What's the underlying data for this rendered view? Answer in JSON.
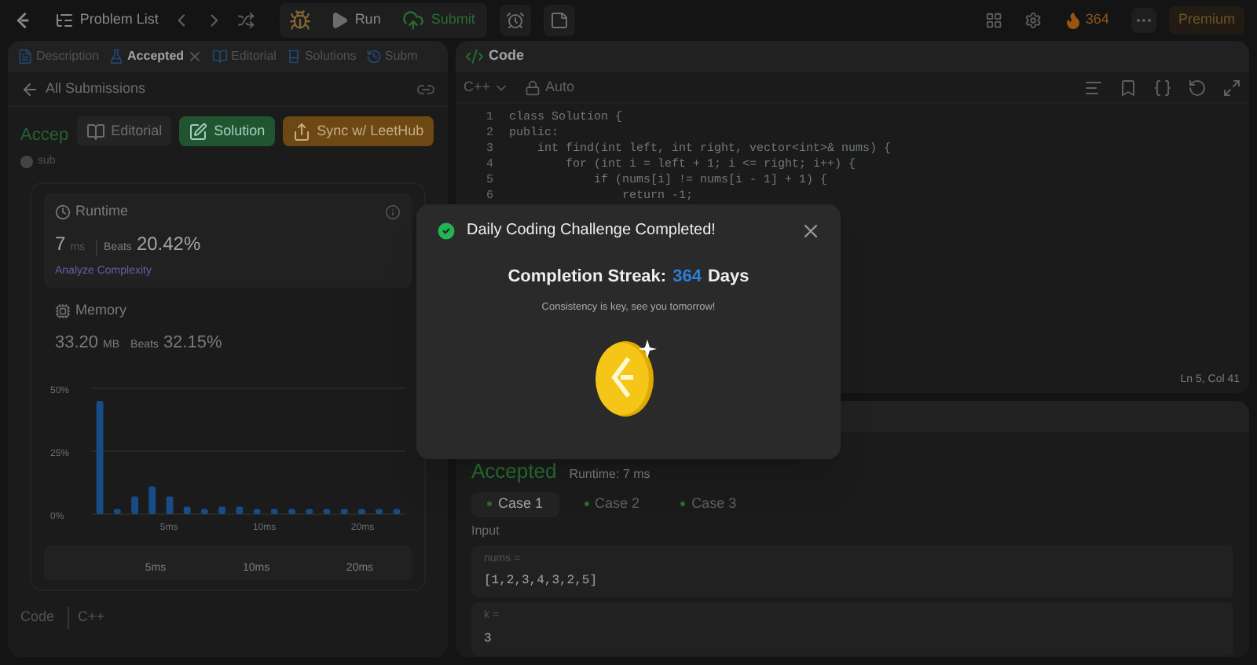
{
  "top_bar": {
    "problem_list": "Problem List",
    "run": "Run",
    "submit": "Submit",
    "streak": "364",
    "premium": "Premium"
  },
  "left_panel": {
    "tabs": [
      {
        "label": "Description",
        "selected": false
      },
      {
        "label": "Accepted",
        "selected": true,
        "closable": true
      },
      {
        "label": "Editorial",
        "selected": false
      },
      {
        "label": "Solutions",
        "selected": false
      },
      {
        "label": "Subm",
        "selected": false
      }
    ],
    "back_link": "All Submissions",
    "status": "Accep",
    "user": "sub",
    "buttons": [
      {
        "label": "Editorial",
        "kind": "plain"
      },
      {
        "label": "Solution",
        "kind": "green"
      },
      {
        "label": "Sync w/ LeetHub",
        "kind": "orange"
      }
    ],
    "runtime": {
      "title": "Runtime",
      "value": "7",
      "unit": "ms",
      "beats_label": "Beats",
      "beats": "20.42%",
      "analyze": "Analyze Complexity"
    },
    "memory": {
      "title": "Memory",
      "value": "33.20",
      "unit": "MB",
      "beats_label": "Beats",
      "beats": "32.15%"
    },
    "chart_data": {
      "type": "bar",
      "values": [
        45,
        2,
        7,
        11,
        7,
        3,
        2,
        3,
        3,
        2,
        2,
        2,
        2,
        2,
        2,
        2,
        2,
        2
      ],
      "ylim": [
        0,
        50
      ],
      "yticks": [
        {
          "value": 0,
          "label": "0%"
        },
        {
          "value": 25,
          "label": "25%"
        },
        {
          "value": 50,
          "label": "50%"
        }
      ]
    },
    "chart_axis_labels": [
      "5ms",
      "10ms",
      "20ms"
    ],
    "navigator_labels": [
      "5ms",
      "10ms",
      "20ms"
    ],
    "code_label": "Code",
    "code_language": "C++"
  },
  "right_panel": {
    "tab": "Code",
    "language": "C++",
    "mode": "Auto",
    "code": [
      {
        "n": "1",
        "text": "class Solution {"
      },
      {
        "n": "2",
        "text": "public:"
      },
      {
        "n": "3",
        "text": "    int find(int left, int right, vector<int>& nums) {"
      },
      {
        "n": "4",
        "text": "        for (int i = left + 1; i <= right; i++) {"
      },
      {
        "n": "5",
        "text": "            if (nums[i] != nums[i - 1] + 1) {"
      },
      {
        "n": "6",
        "text": "                return -1;"
      }
    ],
    "cursor": "Ln 5, Col 41",
    "result": {
      "status": "Accepted",
      "runtime": "Runtime: 7 ms",
      "cases": [
        {
          "label": "Case 1",
          "selected": true
        },
        {
          "label": "Case 2",
          "selected": false
        },
        {
          "label": "Case 3",
          "selected": false
        }
      ],
      "input_label": "Input",
      "inputs": [
        {
          "name": "nums =",
          "value": "[1,2,3,4,3,2,5]"
        },
        {
          "name": "k =",
          "value": "3"
        }
      ]
    }
  },
  "modal": {
    "title": "Daily Coding Challenge Completed!",
    "streak_label": "Completion Streak:",
    "streak_value": "364",
    "streak_unit": "Days",
    "message": "Consistency is key, see you tomorrow!"
  }
}
